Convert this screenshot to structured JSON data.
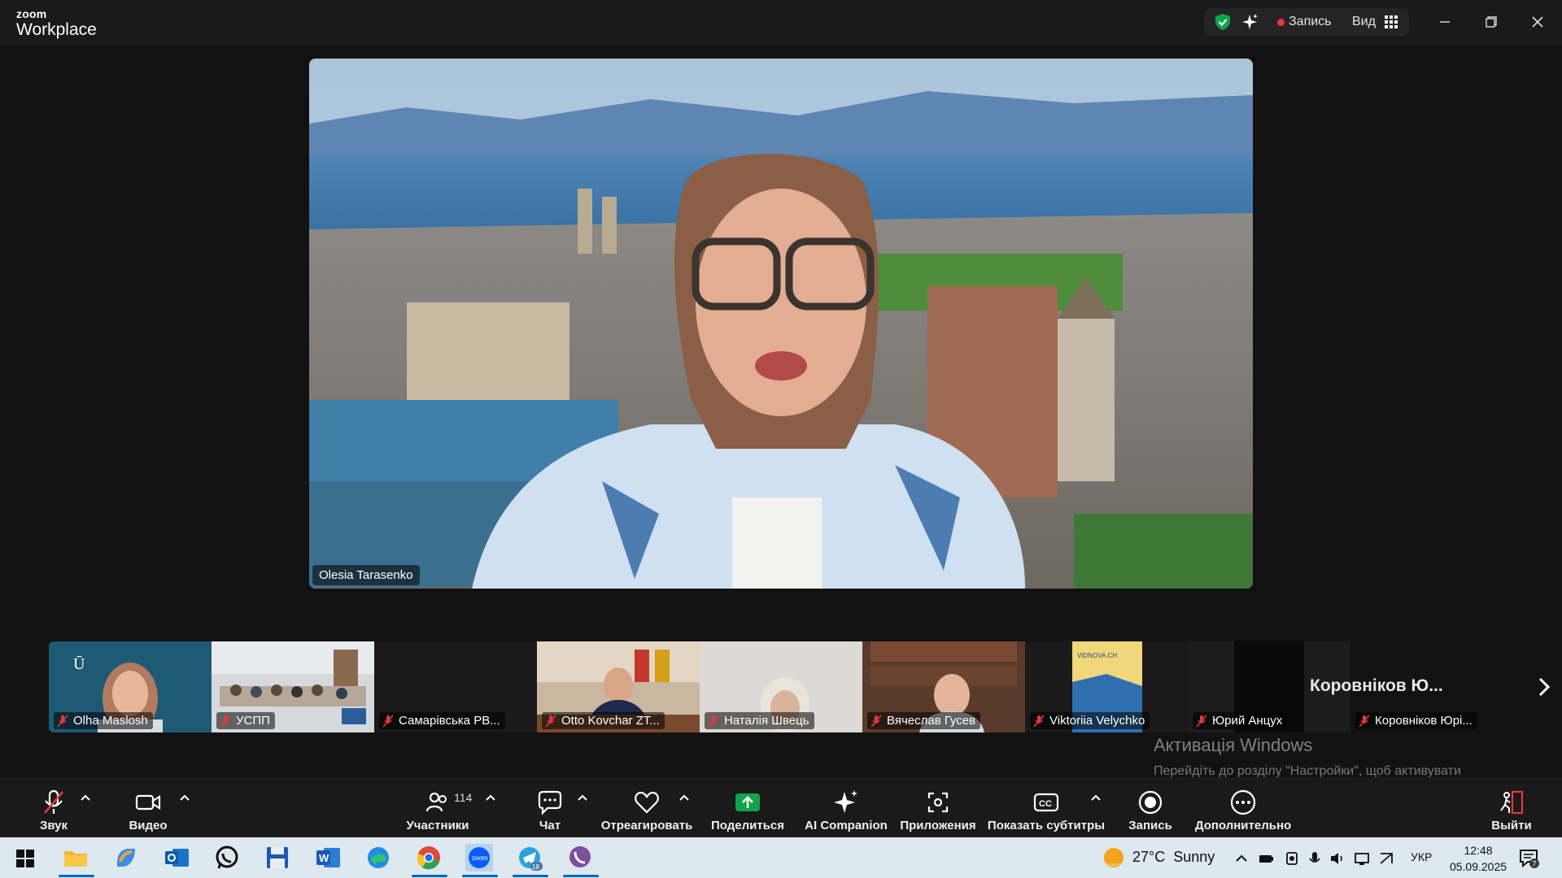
{
  "app": {
    "brand_top": "zoom",
    "brand_bottom": "Workplace"
  },
  "titlebar": {
    "record_label": "Запись",
    "view_label": "Вид"
  },
  "main": {
    "speaker_name": "Olesia Tarasenko"
  },
  "participants": [
    {
      "name": "Olha Maslosh"
    },
    {
      "name": "УСПП"
    },
    {
      "name": "Самарівська РВ..."
    },
    {
      "name": "Otto Kovchar ZT..."
    },
    {
      "name": "Наталія Швець"
    },
    {
      "name": "Вячеслав Гусев"
    },
    {
      "name": "Viktoriia Velychko"
    },
    {
      "name": "Юрий Анцух"
    },
    {
      "name": "Коровніков Юрі..."
    }
  ],
  "featured_name": "Коровніков Ю...",
  "activation": {
    "title": "Активація Windows",
    "subtitle": "Перейдіть до розділу \"Настройки\", щоб активувати Windows."
  },
  "toolbar": {
    "audio": "Звук",
    "video": "Видео",
    "participants": "Участники",
    "participants_count": "114",
    "chat": "Чат",
    "react": "Отреагировать",
    "share": "Поделиться",
    "ai": "AI Companion",
    "apps": "Приложения",
    "captions": "Показать субтитры",
    "record": "Запись",
    "more": "Дополнительно",
    "leave": "Выйти"
  },
  "taskbar": {
    "weather_temp": "27°C",
    "weather_desc": "Sunny",
    "lang": "УКР",
    "time": "12:48",
    "date": "05.09.2025",
    "telegram_badge": "18",
    "notification_badge": "7"
  },
  "colors": {
    "accent_green": "#11a34b",
    "record_red": "#e5383b",
    "taskbar_bg": "#dde8ef",
    "toolbar_bg": "#1a1a1a"
  }
}
